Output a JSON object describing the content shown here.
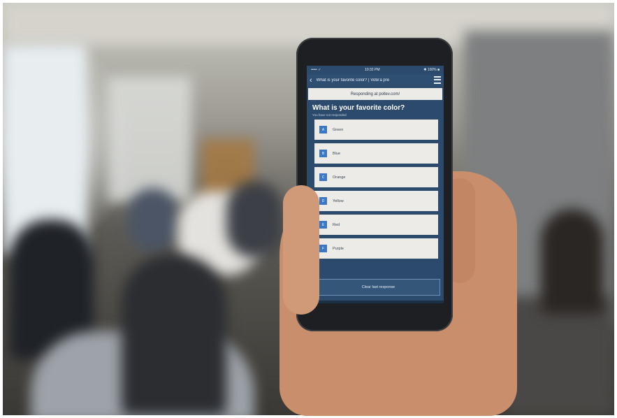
{
  "status_bar": {
    "carrier": "••••• ✓",
    "time": "10:32 PM",
    "battery": "✱ 100% ■"
  },
  "app_bar": {
    "back_icon": "chevron-left-icon",
    "title": "What is your favorite color? | Vote'a pre",
    "menu_icon": "hamburger-menu-icon"
  },
  "responding_banner": "Responding at pollev.com/",
  "question": {
    "title": "What is your favorite color?",
    "subtitle": "You have not responded"
  },
  "options": [
    {
      "key": "A",
      "label": "Green"
    },
    {
      "key": "B",
      "label": "Blue"
    },
    {
      "key": "C",
      "label": "Orange"
    },
    {
      "key": "D",
      "label": "Yellow"
    },
    {
      "key": "E",
      "label": "Red"
    },
    {
      "key": "F",
      "label": "Purple"
    }
  ],
  "clear_button": "Clear last response",
  "colors": {
    "screen_bg": "#2c4a6b",
    "option_key": "#3a77c5",
    "option_bg": "#ecebe8"
  }
}
